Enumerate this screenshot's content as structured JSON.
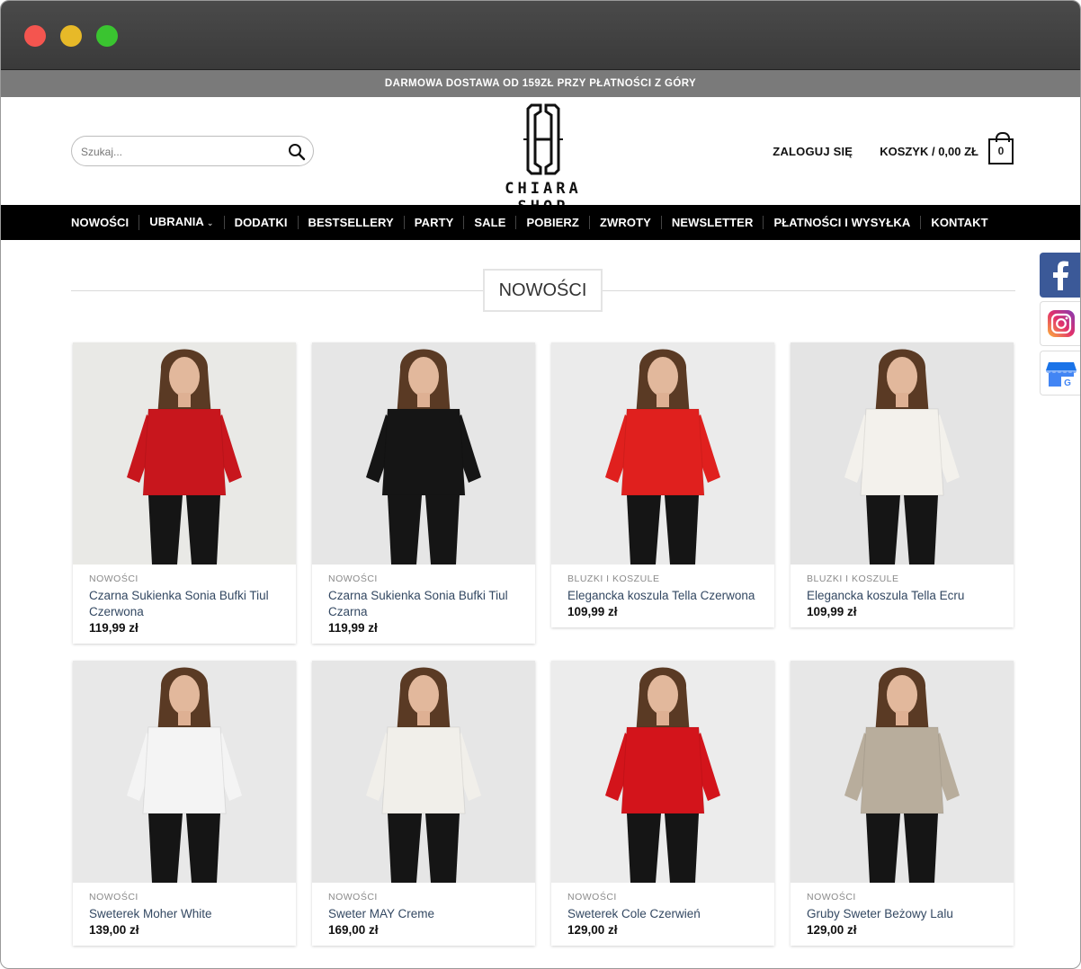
{
  "promo_bar": {
    "text": "DARMOWA DOSTAWA OD 159ZŁ PRZY PŁATNOŚCI Z GÓRY"
  },
  "header": {
    "search_placeholder": "Szukaj...",
    "logo_text": "CHIARA SHOP",
    "login_label": "ZALOGUJ SIĘ",
    "cart_label": "KOSZYK / 0,00 ZŁ",
    "cart_count": "0"
  },
  "nav": {
    "items": [
      {
        "label": "NOWOŚCI"
      },
      {
        "label": "UBRANIA",
        "has_dropdown": true
      },
      {
        "label": "DODATKI"
      },
      {
        "label": "BESTSELLERY"
      },
      {
        "label": "PARTY"
      },
      {
        "label": "SALE"
      },
      {
        "label": "POBIERZ"
      },
      {
        "label": "ZWROTY"
      },
      {
        "label": "NEWSLETTER"
      },
      {
        "label": "PŁATNOŚCI I WYSYŁKA"
      },
      {
        "label": "KONTAKT"
      }
    ]
  },
  "section": {
    "title": "NOWOŚCI"
  },
  "products": [
    {
      "category": "NOWOŚCI",
      "name": "Czarna Sukienka Sonia Bufki Tiul Czerwona",
      "price": "119,99 zł",
      "garment_color": "#c8161d",
      "bg_color": "#e9e9e6"
    },
    {
      "category": "NOWOŚCI",
      "name": "Czarna Sukienka Sonia Bufki Tiul Czarna",
      "price": "119,99 zł",
      "garment_color": "#151515",
      "bg_color": "#e6e6e6"
    },
    {
      "category": "BLUZKI I KOSZULE",
      "name": "Elegancka koszula Tella Czerwona",
      "price": "109,99 zł",
      "garment_color": "#e0201e",
      "bg_color": "#ebebeb"
    },
    {
      "category": "BLUZKI I KOSZULE",
      "name": "Elegancka koszula Tella Ecru",
      "price": "109,99 zł",
      "garment_color": "#f3f1ec",
      "bg_color": "#e4e4e4"
    },
    {
      "category": "NOWOŚCI",
      "name": "Sweterek Moher White",
      "price": "139,00 zł",
      "garment_color": "#f4f4f4",
      "bg_color": "#e8e8e8"
    },
    {
      "category": "NOWOŚCI",
      "name": "Sweter MAY Creme",
      "price": "169,00 zł",
      "garment_color": "#f1efea",
      "bg_color": "#e6e6e6"
    },
    {
      "category": "NOWOŚCI",
      "name": "Sweterek Cole Czerwień",
      "price": "129,00 zł",
      "garment_color": "#d3141b",
      "bg_color": "#ececec"
    },
    {
      "category": "NOWOŚCI",
      "name": "Gruby Sweter Beżowy Lalu",
      "price": "129,00 zł",
      "garment_color": "#b8ad9c",
      "bg_color": "#e7e7e7"
    }
  ],
  "social": [
    {
      "icon": "facebook-icon",
      "color": "#3b5998"
    },
    {
      "icon": "instagram-icon",
      "color": "#d6249f"
    },
    {
      "icon": "google-my-business-icon",
      "color": "#4285f4"
    }
  ]
}
